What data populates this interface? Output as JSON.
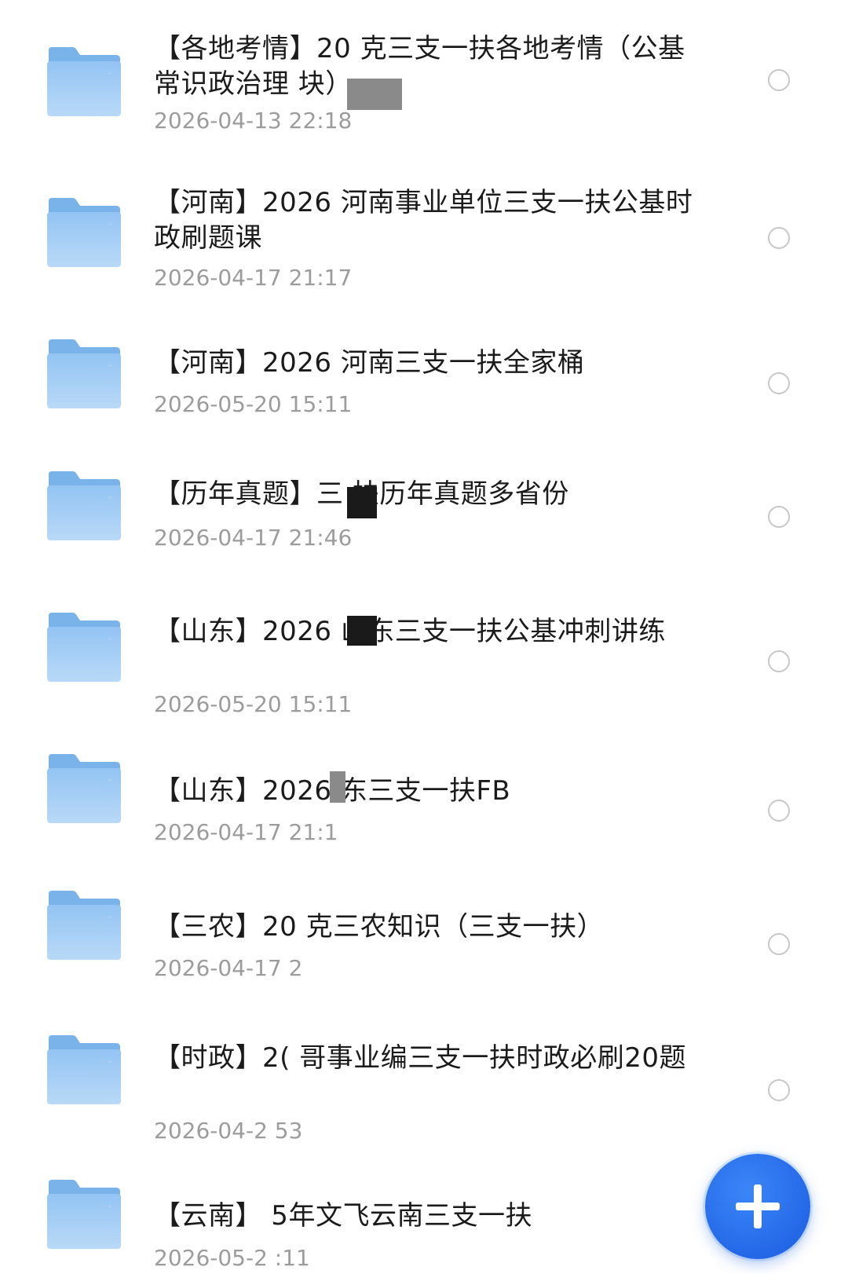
{
  "colors": {
    "folder": "#8ec0f0",
    "folder_tab": "#7ab2ea",
    "accent": "#2468e8",
    "name_text": "#1b1b1b",
    "date_text": "#9c9c9c"
  },
  "files": [
    {
      "icon": "folder-icon",
      "name": "【各地考情】20 克三支一扶各地考情（公基常识政治理 块）",
      "date": "2026-04-13 22:18"
    },
    {
      "icon": "folder-icon",
      "name": "【河南】2026 河南事业单位三支一扶公基时政刷题课",
      "date": "2026-04-17 21:17"
    },
    {
      "icon": "folder-icon",
      "name": "【河南】2026 河南三支一扶全家桶",
      "date": "2026-05-20 15:11"
    },
    {
      "icon": "folder-icon",
      "name": "【历年真题】三 扶历年真题多省份",
      "date": "2026-04-17 21:46"
    },
    {
      "icon": "folder-icon",
      "name": "【山东】2026 山东三支一扶公基冲刺讲练",
      "date": "2026-05-20 15:11"
    },
    {
      "icon": "folder-icon",
      "name": "【山东】2026 东三支一扶FB",
      "date": "2026-04-17 21:1"
    },
    {
      "icon": "folder-icon",
      "name": "【三农】20 克三农知识（三支一扶）",
      "date": "2026-04-17 2"
    },
    {
      "icon": "folder-icon",
      "name": "【时政】2( 哥事业编三支一扶时政必刷20题",
      "date": "2026-04-2 53"
    },
    {
      "icon": "folder-icon",
      "name": "【云南】 5年文飞云南三支一扶",
      "date": "2026-05-2 :11"
    }
  ],
  "fab": {
    "icon": "plus-icon"
  }
}
